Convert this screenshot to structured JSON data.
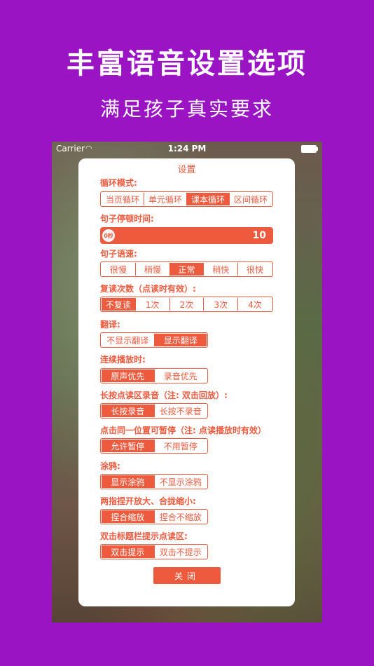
{
  "headline": "丰富语音设置选项",
  "subline": "满足孩子真实要求",
  "statusbar": {
    "carrier": "Carrier",
    "wifi_icon": "wifi-icon",
    "time": "1:24 PM"
  },
  "dialog": {
    "title": "设置",
    "loop": {
      "label": "循环模式:",
      "options": [
        "当页循环",
        "单元循环",
        "课本循环",
        "区间循环"
      ],
      "selected": 2
    },
    "pause": {
      "label": "句子停顿时间:",
      "knob": "0秒",
      "value": "10"
    },
    "speed": {
      "label": "句子语速:",
      "options": [
        "很慢",
        "稍慢",
        "正常",
        "稍快",
        "很快"
      ],
      "selected": 2
    },
    "repeat": {
      "label": "复读次数（点读时有效）:",
      "options": [
        "不复读",
        "1次",
        "2次",
        "3次",
        "4次"
      ],
      "selected": 0
    },
    "translate": {
      "label": "翻译:",
      "options": [
        "不显示翻译",
        "显示翻译"
      ],
      "selected": 1
    },
    "continuous": {
      "label": "连续播放时:",
      "options": [
        "原声优先",
        "录音优先"
      ],
      "selected": 0
    },
    "longpress": {
      "label": "长按点读区录音（注: 双击回放）:",
      "options": [
        "长按录音",
        "长按不录音"
      ],
      "selected": 0
    },
    "tap_pause": {
      "label": "点击同一位置可暂停（注: 点读播放时有效）",
      "options": [
        "允许暂停",
        "不用暂停"
      ],
      "selected": 0
    },
    "doodle": {
      "label": "涂鸦:",
      "options": [
        "显示涂鸦",
        "不显示涂鸦"
      ],
      "selected": 0
    },
    "pinch": {
      "label": "两指捏开放大、合拢缩小:",
      "options": [
        "捏合缩放",
        "捏合不缩放"
      ],
      "selected": 0
    },
    "double_tap": {
      "label": "双击标题栏提示点读区:",
      "options": [
        "双击提示",
        "双击不提示"
      ],
      "selected": 0
    },
    "close_label": "关闭"
  }
}
